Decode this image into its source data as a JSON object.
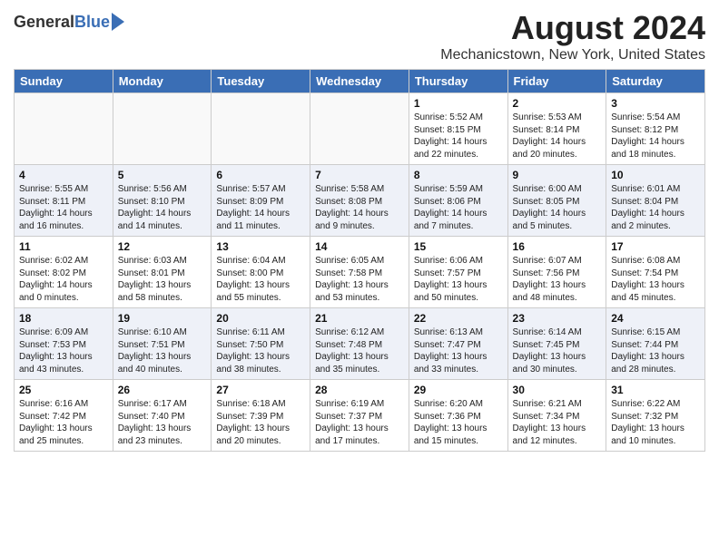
{
  "header": {
    "logo_general": "General",
    "logo_blue": "Blue",
    "main_title": "August 2024",
    "subtitle": "Mechanicstown, New York, United States"
  },
  "calendar": {
    "days_of_week": [
      "Sunday",
      "Monday",
      "Tuesday",
      "Wednesday",
      "Thursday",
      "Friday",
      "Saturday"
    ],
    "weeks": [
      {
        "row_class": "row-odd",
        "days": [
          {
            "num": "",
            "info": "",
            "empty": true
          },
          {
            "num": "",
            "info": "",
            "empty": true
          },
          {
            "num": "",
            "info": "",
            "empty": true
          },
          {
            "num": "",
            "info": "",
            "empty": true
          },
          {
            "num": "1",
            "info": "Sunrise: 5:52 AM\nSunset: 8:15 PM\nDaylight: 14 hours\nand 22 minutes.",
            "empty": false
          },
          {
            "num": "2",
            "info": "Sunrise: 5:53 AM\nSunset: 8:14 PM\nDaylight: 14 hours\nand 20 minutes.",
            "empty": false
          },
          {
            "num": "3",
            "info": "Sunrise: 5:54 AM\nSunset: 8:12 PM\nDaylight: 14 hours\nand 18 minutes.",
            "empty": false
          }
        ]
      },
      {
        "row_class": "row-even",
        "days": [
          {
            "num": "4",
            "info": "Sunrise: 5:55 AM\nSunset: 8:11 PM\nDaylight: 14 hours\nand 16 minutes.",
            "empty": false
          },
          {
            "num": "5",
            "info": "Sunrise: 5:56 AM\nSunset: 8:10 PM\nDaylight: 14 hours\nand 14 minutes.",
            "empty": false
          },
          {
            "num": "6",
            "info": "Sunrise: 5:57 AM\nSunset: 8:09 PM\nDaylight: 14 hours\nand 11 minutes.",
            "empty": false
          },
          {
            "num": "7",
            "info": "Sunrise: 5:58 AM\nSunset: 8:08 PM\nDaylight: 14 hours\nand 9 minutes.",
            "empty": false
          },
          {
            "num": "8",
            "info": "Sunrise: 5:59 AM\nSunset: 8:06 PM\nDaylight: 14 hours\nand 7 minutes.",
            "empty": false
          },
          {
            "num": "9",
            "info": "Sunrise: 6:00 AM\nSunset: 8:05 PM\nDaylight: 14 hours\nand 5 minutes.",
            "empty": false
          },
          {
            "num": "10",
            "info": "Sunrise: 6:01 AM\nSunset: 8:04 PM\nDaylight: 14 hours\nand 2 minutes.",
            "empty": false
          }
        ]
      },
      {
        "row_class": "row-odd",
        "days": [
          {
            "num": "11",
            "info": "Sunrise: 6:02 AM\nSunset: 8:02 PM\nDaylight: 14 hours\nand 0 minutes.",
            "empty": false
          },
          {
            "num": "12",
            "info": "Sunrise: 6:03 AM\nSunset: 8:01 PM\nDaylight: 13 hours\nand 58 minutes.",
            "empty": false
          },
          {
            "num": "13",
            "info": "Sunrise: 6:04 AM\nSunset: 8:00 PM\nDaylight: 13 hours\nand 55 minutes.",
            "empty": false
          },
          {
            "num": "14",
            "info": "Sunrise: 6:05 AM\nSunset: 7:58 PM\nDaylight: 13 hours\nand 53 minutes.",
            "empty": false
          },
          {
            "num": "15",
            "info": "Sunrise: 6:06 AM\nSunset: 7:57 PM\nDaylight: 13 hours\nand 50 minutes.",
            "empty": false
          },
          {
            "num": "16",
            "info": "Sunrise: 6:07 AM\nSunset: 7:56 PM\nDaylight: 13 hours\nand 48 minutes.",
            "empty": false
          },
          {
            "num": "17",
            "info": "Sunrise: 6:08 AM\nSunset: 7:54 PM\nDaylight: 13 hours\nand 45 minutes.",
            "empty": false
          }
        ]
      },
      {
        "row_class": "row-even",
        "days": [
          {
            "num": "18",
            "info": "Sunrise: 6:09 AM\nSunset: 7:53 PM\nDaylight: 13 hours\nand 43 minutes.",
            "empty": false
          },
          {
            "num": "19",
            "info": "Sunrise: 6:10 AM\nSunset: 7:51 PM\nDaylight: 13 hours\nand 40 minutes.",
            "empty": false
          },
          {
            "num": "20",
            "info": "Sunrise: 6:11 AM\nSunset: 7:50 PM\nDaylight: 13 hours\nand 38 minutes.",
            "empty": false
          },
          {
            "num": "21",
            "info": "Sunrise: 6:12 AM\nSunset: 7:48 PM\nDaylight: 13 hours\nand 35 minutes.",
            "empty": false
          },
          {
            "num": "22",
            "info": "Sunrise: 6:13 AM\nSunset: 7:47 PM\nDaylight: 13 hours\nand 33 minutes.",
            "empty": false
          },
          {
            "num": "23",
            "info": "Sunrise: 6:14 AM\nSunset: 7:45 PM\nDaylight: 13 hours\nand 30 minutes.",
            "empty": false
          },
          {
            "num": "24",
            "info": "Sunrise: 6:15 AM\nSunset: 7:44 PM\nDaylight: 13 hours\nand 28 minutes.",
            "empty": false
          }
        ]
      },
      {
        "row_class": "row-odd",
        "days": [
          {
            "num": "25",
            "info": "Sunrise: 6:16 AM\nSunset: 7:42 PM\nDaylight: 13 hours\nand 25 minutes.",
            "empty": false
          },
          {
            "num": "26",
            "info": "Sunrise: 6:17 AM\nSunset: 7:40 PM\nDaylight: 13 hours\nand 23 minutes.",
            "empty": false
          },
          {
            "num": "27",
            "info": "Sunrise: 6:18 AM\nSunset: 7:39 PM\nDaylight: 13 hours\nand 20 minutes.",
            "empty": false
          },
          {
            "num": "28",
            "info": "Sunrise: 6:19 AM\nSunset: 7:37 PM\nDaylight: 13 hours\nand 17 minutes.",
            "empty": false
          },
          {
            "num": "29",
            "info": "Sunrise: 6:20 AM\nSunset: 7:36 PM\nDaylight: 13 hours\nand 15 minutes.",
            "empty": false
          },
          {
            "num": "30",
            "info": "Sunrise: 6:21 AM\nSunset: 7:34 PM\nDaylight: 13 hours\nand 12 minutes.",
            "empty": false
          },
          {
            "num": "31",
            "info": "Sunrise: 6:22 AM\nSunset: 7:32 PM\nDaylight: 13 hours\nand 10 minutes.",
            "empty": false
          }
        ]
      }
    ]
  }
}
